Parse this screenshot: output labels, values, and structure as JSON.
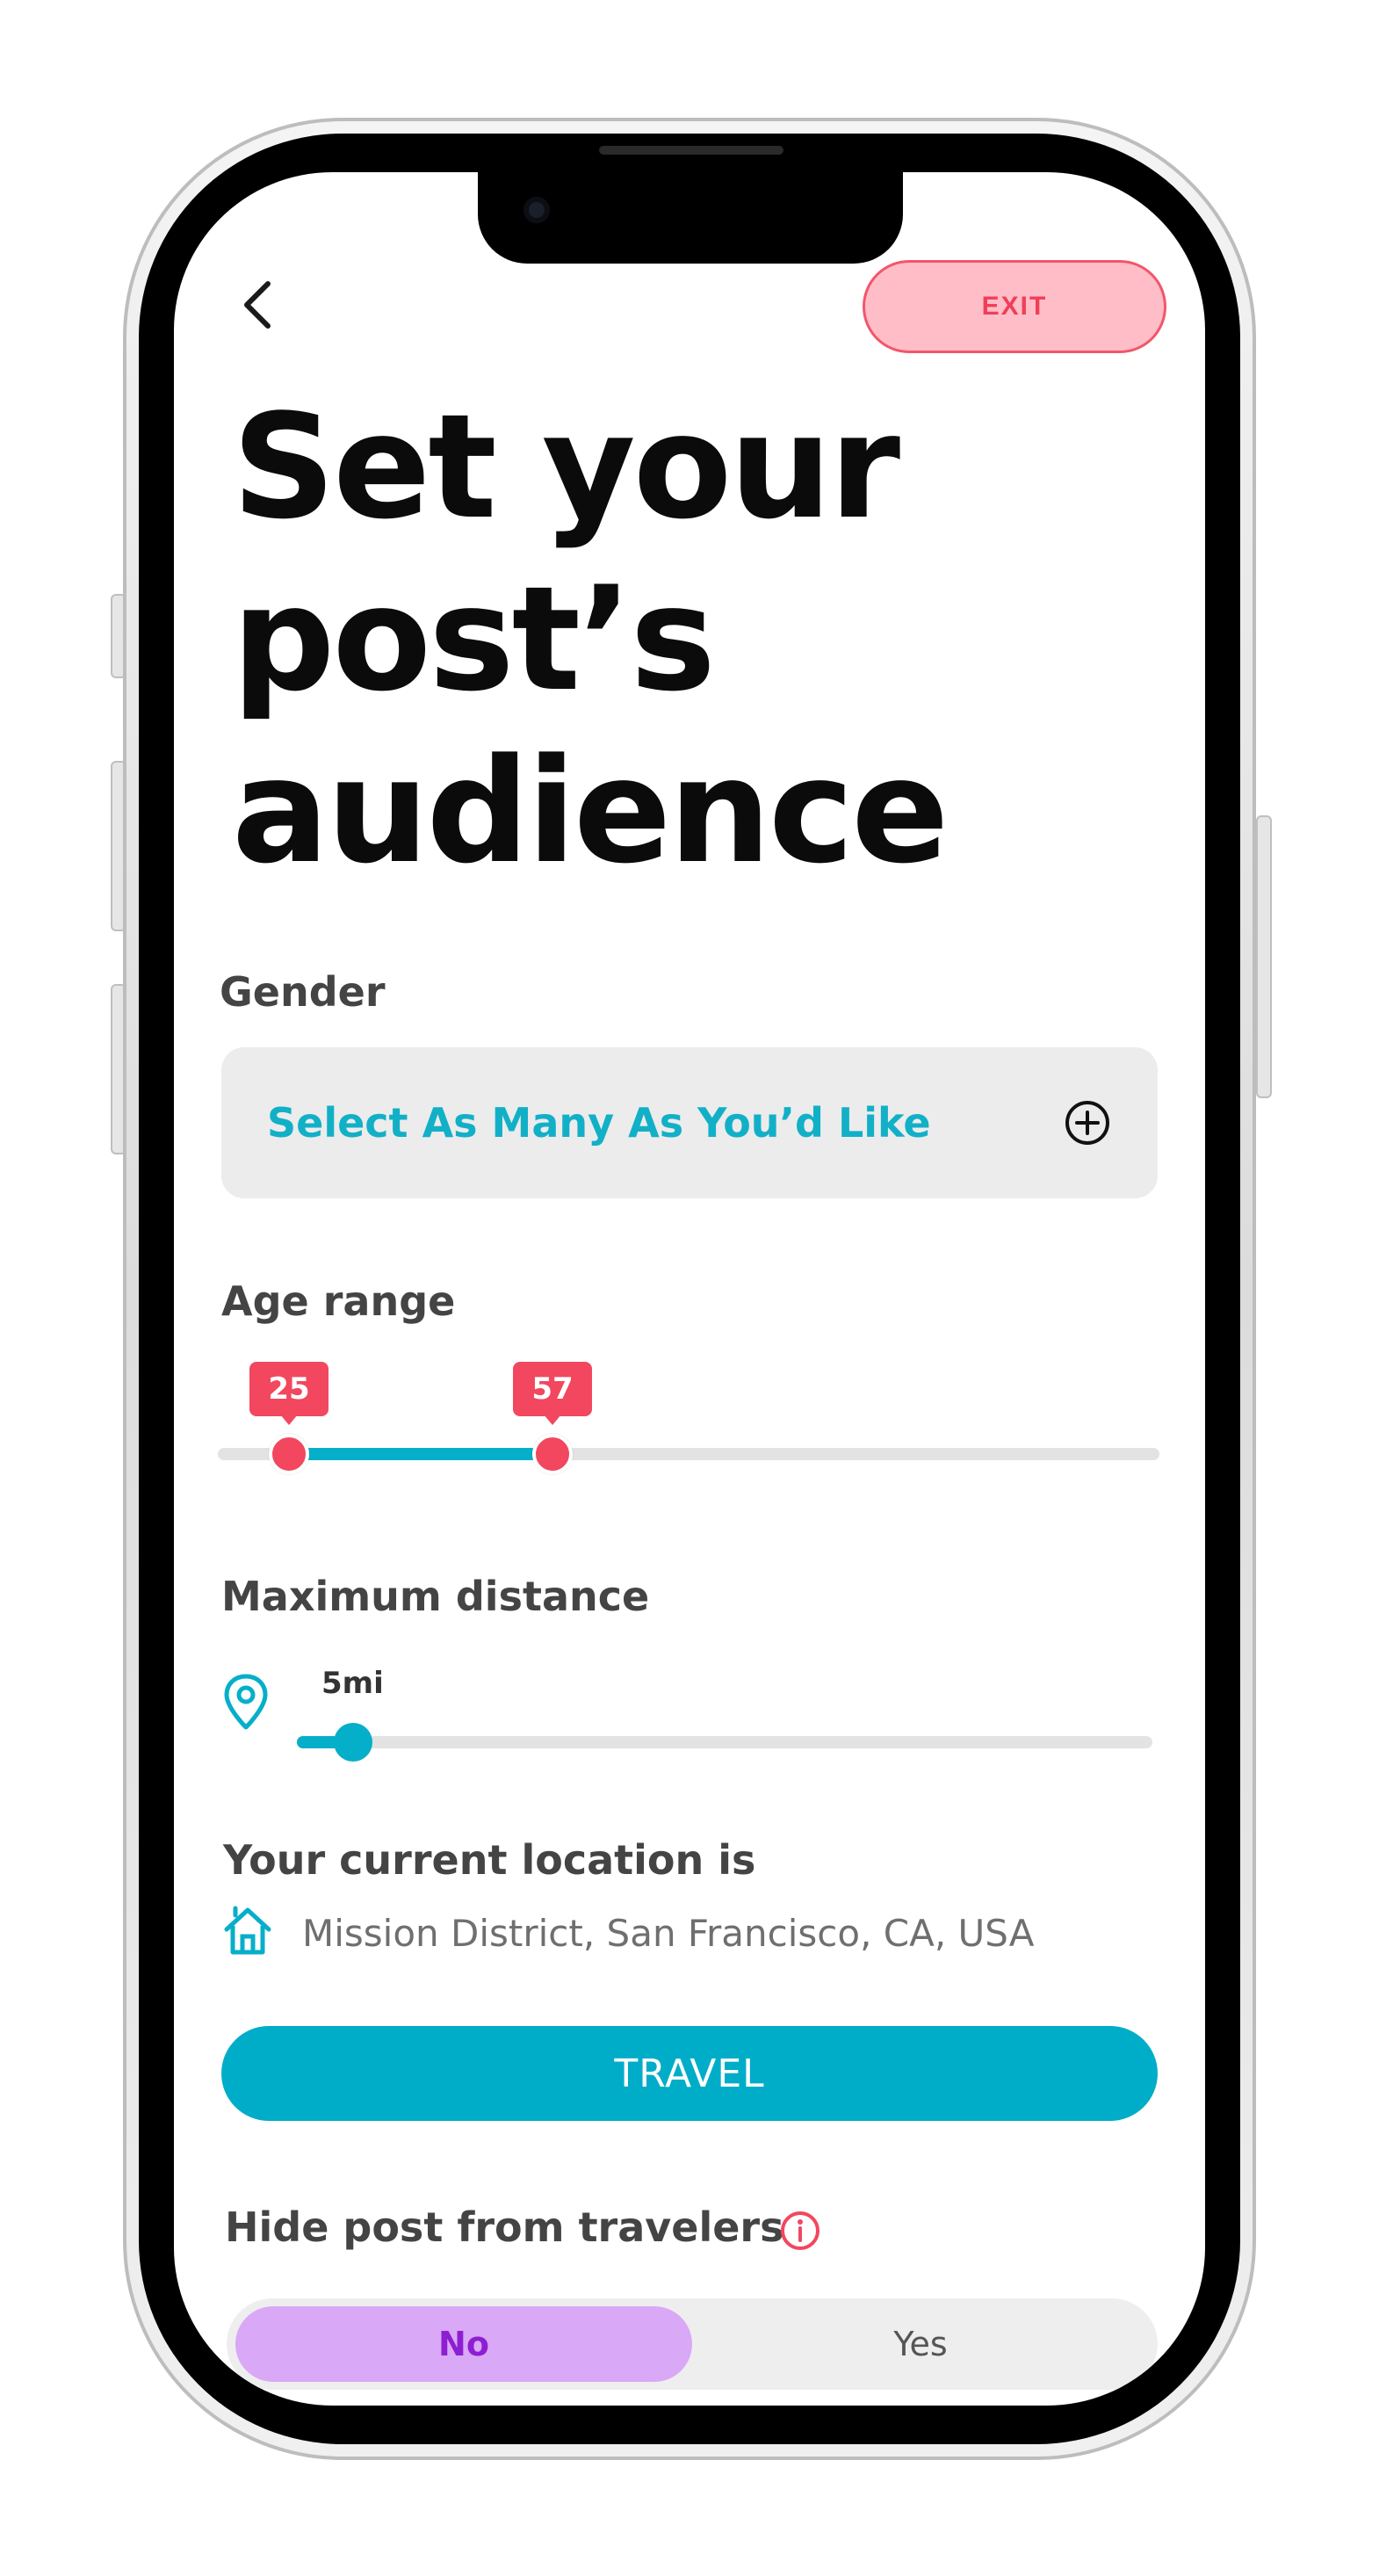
{
  "header": {
    "exit_label": "EXIT"
  },
  "title": {
    "line1": "Set your",
    "line2": "post’s",
    "line3": "audience"
  },
  "gender": {
    "label": "Gender",
    "placeholder": "Select As Many As You’d Like"
  },
  "age_range": {
    "label": "Age range",
    "min_value": "25",
    "max_value": "57",
    "min": 25,
    "max": 57
  },
  "max_distance": {
    "label": "Maximum distance",
    "value_label": "5mi",
    "value": 5
  },
  "location": {
    "label": "Your current location is",
    "address": "Mission District, San Francisco, CA, USA"
  },
  "travel_button": {
    "label": "TRAVEL"
  },
  "hide_from_travelers": {
    "label": "Hide post from travelers",
    "options": [
      "No",
      "Yes"
    ],
    "selected": "No"
  },
  "colors": {
    "accent_teal": "#06afc9",
    "accent_red": "#f2475f",
    "toggle_purple": "#d9a8f6"
  }
}
